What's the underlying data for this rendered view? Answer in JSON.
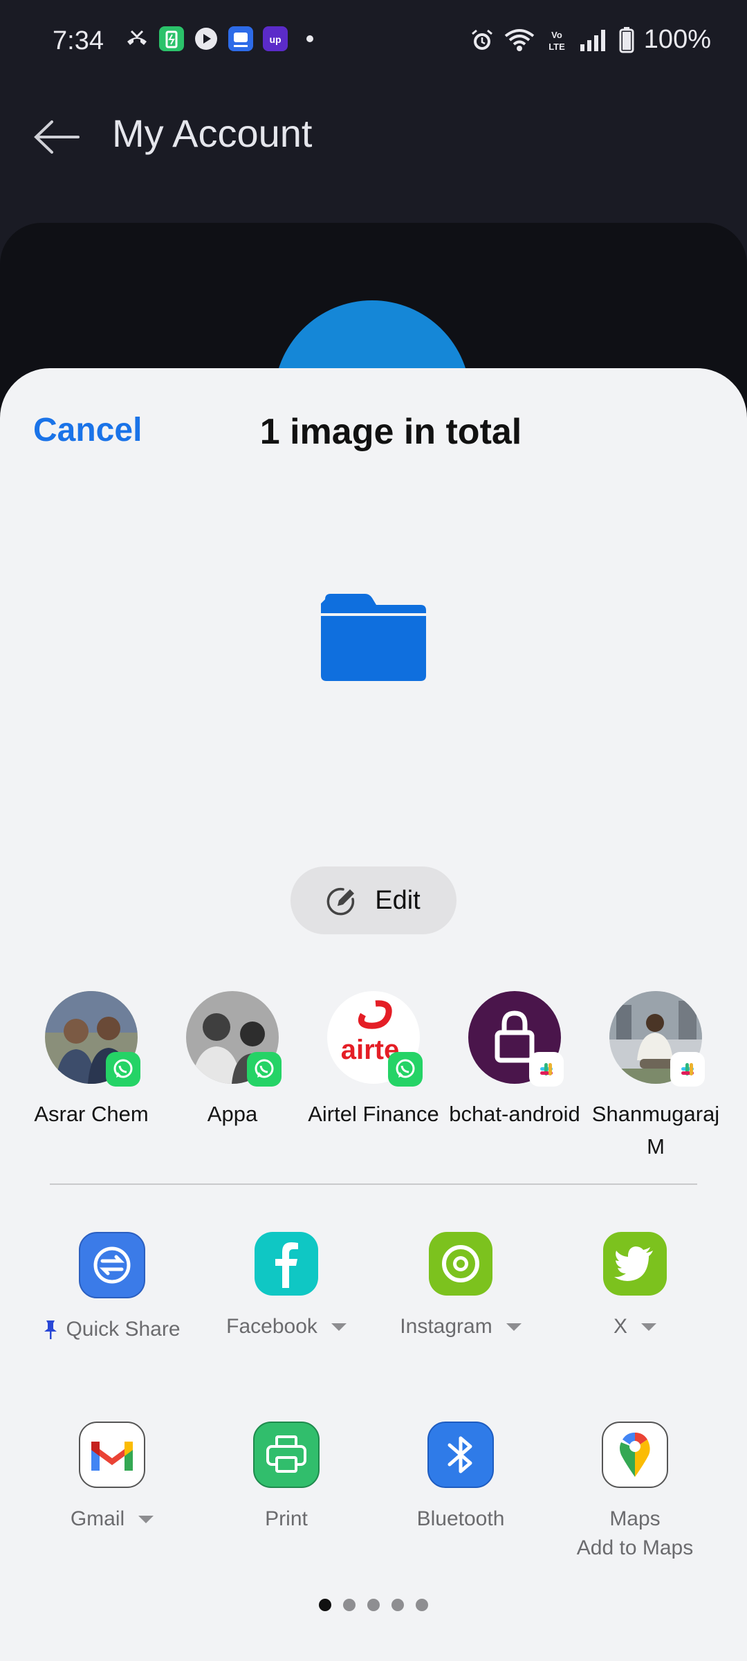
{
  "status_bar": {
    "time": "7:34",
    "battery": "100%",
    "left_icons": [
      "missed-call-icon",
      "battery-saver-app-icon",
      "play-icon",
      "teamviewer-app-icon",
      "upi-app-icon",
      "notification-dot-icon"
    ],
    "right_icons": [
      "alarm-icon",
      "wifi-icon",
      "volte-icon",
      "signal-icon",
      "battery-icon"
    ]
  },
  "appbar": {
    "title": "My Account"
  },
  "sheet": {
    "cancel_label": "Cancel",
    "title": "1 image in total",
    "edit_label": "Edit",
    "contacts": [
      {
        "name": "Asrar Chem",
        "badge": "whatsapp"
      },
      {
        "name": "Appa",
        "badge": "whatsapp"
      },
      {
        "name": "Airtel Finance",
        "badge": "whatsapp"
      },
      {
        "name": "bchat-android",
        "badge": "slack"
      },
      {
        "name": "Shanmugaraj M",
        "badge": "slack"
      }
    ],
    "apps_row1": [
      {
        "label": "Quick Share",
        "pinned": true,
        "color": "#3b7be8"
      },
      {
        "label": "Facebook",
        "dropdown": true,
        "color": "#0fc7c4"
      },
      {
        "label": "Instagram",
        "dropdown": true,
        "color": "#7cc21e"
      },
      {
        "label": "X",
        "dropdown": true,
        "color": "#7cc21e"
      }
    ],
    "apps_row2": [
      {
        "label": "Gmail",
        "dropdown": true
      },
      {
        "label": "Print"
      },
      {
        "label": "Bluetooth"
      },
      {
        "label": "Maps",
        "sub": "Add to Maps"
      }
    ],
    "pager": {
      "pages": 5,
      "active": 1
    }
  },
  "colors": {
    "accent": "#1a73e8",
    "folder": "#0f6fde",
    "whatsapp": "#25d366",
    "slack": "#4a154b",
    "sheet_bg": "#f2f3f5"
  }
}
